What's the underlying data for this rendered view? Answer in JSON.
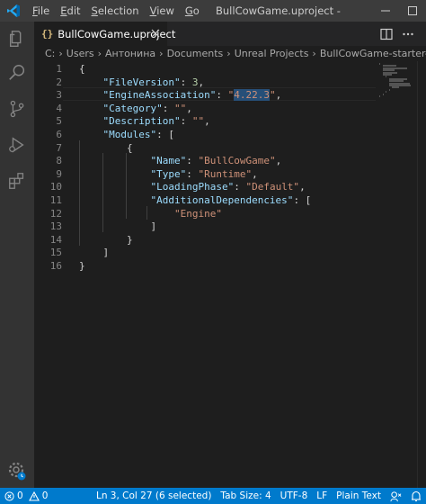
{
  "titlebar": {
    "menu": [
      {
        "label": "File",
        "accel": "F",
        "rest": "ile"
      },
      {
        "label": "Edit",
        "accel": "E",
        "rest": "dit"
      },
      {
        "label": "Selection",
        "accel": "S",
        "rest": "election"
      },
      {
        "label": "View",
        "accel": "V",
        "rest": "iew"
      },
      {
        "label": "Go",
        "accel": "G",
        "rest": "o"
      }
    ],
    "window_title": "BullCowGame.uproject - Vis..."
  },
  "tab": {
    "icon_glyph": "{}",
    "label": "BullCowGame.uproject",
    "close_glyph": "×"
  },
  "breadcrumbs": [
    "C:",
    "Users",
    "Антонина",
    "Documents",
    "Unreal Projects",
    "BullCowGame-starter-kit",
    "..."
  ],
  "breadcrumb_separator": "›",
  "editor": {
    "line_numbers": [
      "1",
      "2",
      "3",
      "4",
      "5",
      "6",
      "7",
      "8",
      "9",
      "10",
      "11",
      "12",
      "13",
      "14",
      "15",
      "16"
    ],
    "lines": [
      [
        {
          "t": "{",
          "c": "p"
        }
      ],
      [
        {
          "t": "    ",
          "c": "p"
        },
        {
          "t": "\"FileVersion\"",
          "c": "k"
        },
        {
          "t": ": ",
          "c": "p"
        },
        {
          "t": "3",
          "c": "n"
        },
        {
          "t": ",",
          "c": "p"
        }
      ],
      [
        {
          "t": "    ",
          "c": "p"
        },
        {
          "t": "\"EngineAssociation\"",
          "c": "k"
        },
        {
          "t": ": ",
          "c": "p"
        },
        {
          "t": "\"",
          "c": "s"
        },
        {
          "t": "4.22.3",
          "c": "s sel"
        },
        {
          "t": "\"",
          "c": "s"
        },
        {
          "t": ",",
          "c": "p"
        }
      ],
      [
        {
          "t": "    ",
          "c": "p"
        },
        {
          "t": "\"Category\"",
          "c": "k"
        },
        {
          "t": ": ",
          "c": "p"
        },
        {
          "t": "\"\"",
          "c": "s"
        },
        {
          "t": ",",
          "c": "p"
        }
      ],
      [
        {
          "t": "    ",
          "c": "p"
        },
        {
          "t": "\"Description\"",
          "c": "k"
        },
        {
          "t": ": ",
          "c": "p"
        },
        {
          "t": "\"\"",
          "c": "s"
        },
        {
          "t": ",",
          "c": "p"
        }
      ],
      [
        {
          "t": "    ",
          "c": "p"
        },
        {
          "t": "\"Modules\"",
          "c": "k"
        },
        {
          "t": ": [",
          "c": "p"
        }
      ],
      [
        {
          "t": "        {",
          "c": "p"
        }
      ],
      [
        {
          "t": "            ",
          "c": "p"
        },
        {
          "t": "\"Name\"",
          "c": "k"
        },
        {
          "t": ": ",
          "c": "p"
        },
        {
          "t": "\"BullCowGame\"",
          "c": "s"
        },
        {
          "t": ",",
          "c": "p"
        }
      ],
      [
        {
          "t": "            ",
          "c": "p"
        },
        {
          "t": "\"Type\"",
          "c": "k"
        },
        {
          "t": ": ",
          "c": "p"
        },
        {
          "t": "\"Runtime\"",
          "c": "s"
        },
        {
          "t": ",",
          "c": "p"
        }
      ],
      [
        {
          "t": "            ",
          "c": "p"
        },
        {
          "t": "\"LoadingPhase\"",
          "c": "k"
        },
        {
          "t": ": ",
          "c": "p"
        },
        {
          "t": "\"Default\"",
          "c": "s"
        },
        {
          "t": ",",
          "c": "p"
        }
      ],
      [
        {
          "t": "            ",
          "c": "p"
        },
        {
          "t": "\"AdditionalDependencies\"",
          "c": "k"
        },
        {
          "t": ": [",
          "c": "p"
        }
      ],
      [
        {
          "t": "                ",
          "c": "p"
        },
        {
          "t": "\"Engine\"",
          "c": "s"
        }
      ],
      [
        {
          "t": "            ]",
          "c": "p"
        }
      ],
      [
        {
          "t": "        }",
          "c": "p"
        }
      ],
      [
        {
          "t": "    ]",
          "c": "p"
        }
      ],
      [
        {
          "t": "}",
          "c": "p"
        }
      ]
    ]
  },
  "statusbar": {
    "errors": "0",
    "warnings": "0",
    "cursor": "Ln 3, Col 27 (6 selected)",
    "tab_size": "Tab Size: 4",
    "encoding": "UTF-8",
    "eol": "LF",
    "language": "Plain Text"
  },
  "colors": {
    "accent": "#007acc",
    "titlebar": "#3c3c3c",
    "activitybar": "#333333",
    "editor_bg": "#1e1e1e",
    "json_key": "#9cdcfe",
    "json_string": "#ce9178",
    "json_number": "#b5cea8",
    "selection": "#264f78"
  },
  "icons": {
    "activity": [
      "files-icon",
      "search-icon",
      "source-control-icon",
      "run-debug-icon",
      "extensions-icon",
      "settings-gear-icon"
    ],
    "tab_actions": [
      "split-editor-icon",
      "more-actions-icon"
    ],
    "status": [
      "error-icon",
      "warning-icon",
      "feedback-icon",
      "notifications-bell-icon"
    ]
  }
}
